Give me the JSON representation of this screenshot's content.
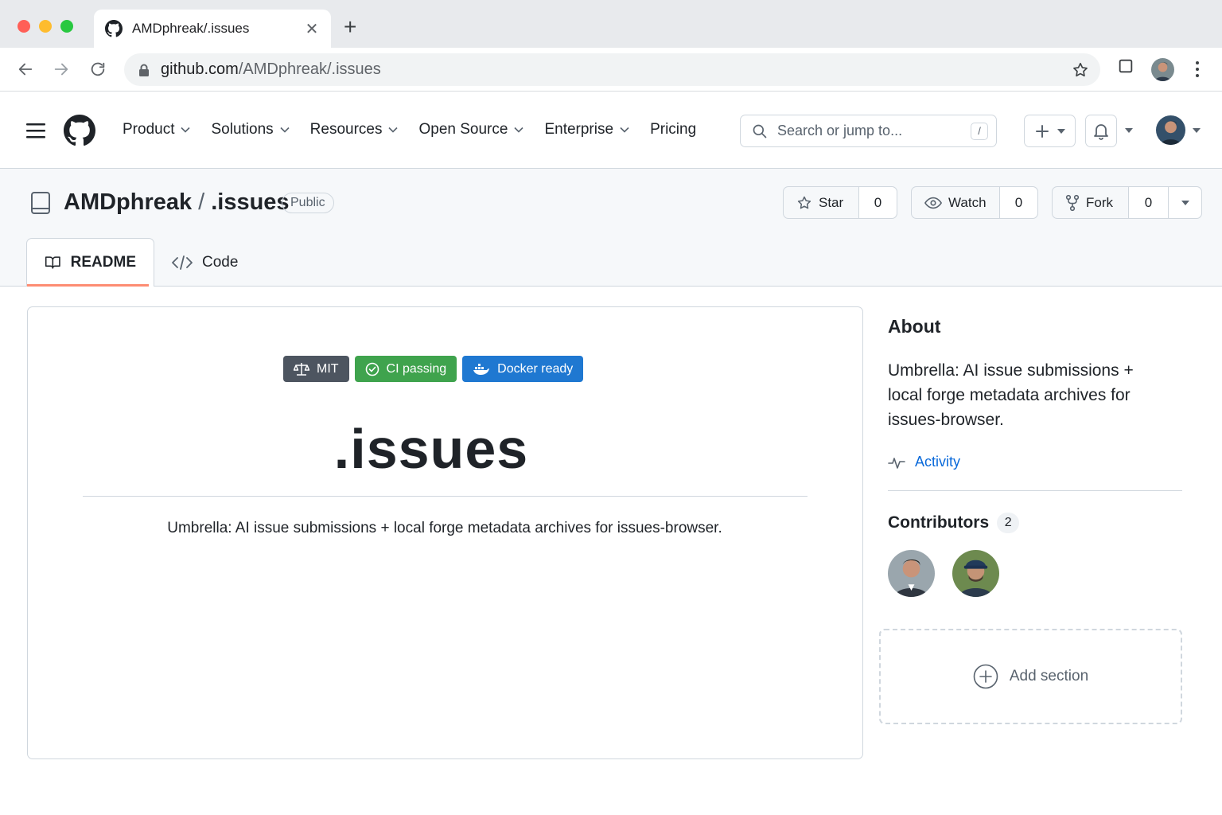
{
  "browser": {
    "tab_title": "AMDphreak/.issues",
    "url_host": "github.com",
    "url_path": "/AMDphreak/.issues"
  },
  "header": {
    "nav": [
      "Product",
      "Solutions",
      "Resources",
      "Open Source",
      "Enterprise",
      "Pricing"
    ],
    "search_placeholder": "Search or jump to...",
    "search_key": "/"
  },
  "repo": {
    "owner": "AMDphreak",
    "separator": "/",
    "name": ".issues",
    "visibility": "Public",
    "star_label": "Star",
    "star_count": "0",
    "watch_label": "Watch",
    "watch_count": "0",
    "fork_label": "Fork",
    "fork_count": "0",
    "tabs": {
      "readme": "README",
      "code": "Code"
    }
  },
  "readme": {
    "badges": {
      "license": "MIT",
      "ci": "CI passing",
      "docker": "Docker ready"
    },
    "heading": ".issues",
    "description": "Umbrella: AI issue submissions + local forge metadata archives for issues-browser."
  },
  "about": {
    "heading": "About",
    "description": "Umbrella: AI issue submissions + local forge metadata archives for issues-browser.",
    "activity_label": "Activity"
  },
  "contributors": {
    "heading": "Contributors",
    "count": "2"
  },
  "add_section_label": "Add section",
  "colors": {
    "link": "#0969da",
    "tab_underline": "#fd8c73",
    "badge_mit": "#4d5560",
    "badge_ci": "#3fa34d",
    "badge_docker": "#1f78d1"
  }
}
